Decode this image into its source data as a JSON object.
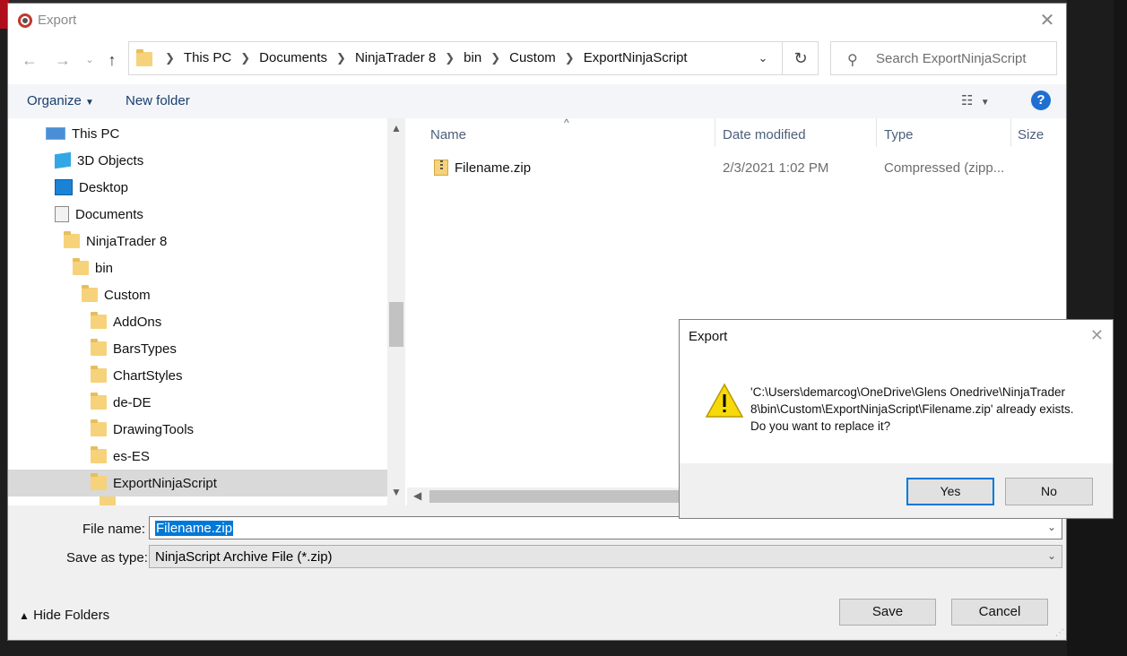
{
  "window": {
    "title": "Export"
  },
  "address": {
    "crumbs": [
      "This PC",
      "Documents",
      "NinjaTrader 8",
      "bin",
      "Custom",
      "ExportNinjaScript"
    ]
  },
  "search": {
    "placeholder": "Search ExportNinjaScript"
  },
  "commands": {
    "organize": "Organize",
    "new_folder": "New folder"
  },
  "tree": [
    {
      "label": "This PC",
      "icon": "pc-icon"
    },
    {
      "label": "3D Objects",
      "icon": "cube-icon"
    },
    {
      "label": "Desktop",
      "icon": "desktop-icon"
    },
    {
      "label": "Documents",
      "icon": "document-icon"
    },
    {
      "label": "NinjaTrader 8",
      "icon": "folder-icon"
    },
    {
      "label": "bin",
      "icon": "folder-icon"
    },
    {
      "label": "Custom",
      "icon": "folder-icon"
    },
    {
      "label": "AddOns",
      "icon": "folder-icon"
    },
    {
      "label": "BarsTypes",
      "icon": "folder-icon"
    },
    {
      "label": "ChartStyles",
      "icon": "folder-icon"
    },
    {
      "label": "de-DE",
      "icon": "folder-icon"
    },
    {
      "label": "DrawingTools",
      "icon": "folder-icon"
    },
    {
      "label": "es-ES",
      "icon": "folder-icon"
    },
    {
      "label": "ExportNinjaScript",
      "icon": "folder-icon",
      "selected": true
    }
  ],
  "columns": {
    "name": "Name",
    "date": "Date modified",
    "type": "Type",
    "size": "Size"
  },
  "files": [
    {
      "name": "Filename.zip",
      "date": "2/3/2021 1:02 PM",
      "type": "Compressed (zipp..."
    }
  ],
  "form": {
    "file_name_label": "File name:",
    "file_name_value": "Filename.zip",
    "save_type_label": "Save as type:",
    "save_type_value": "NinjaScript Archive File (*.zip)",
    "hide_folders": "Hide Folders",
    "save": "Save",
    "cancel": "Cancel"
  },
  "confirm": {
    "title": "Export",
    "message_line1": "'C:\\Users\\demarcog\\OneDrive\\Glens Onedrive\\NinjaTrader",
    "message_line2": "8\\bin\\Custom\\ExportNinjaScript\\Filename.zip' already exists.",
    "message_line3": "Do you want to replace it?",
    "yes": "Yes",
    "no": "No"
  },
  "colors": {
    "accent": "#0078d7",
    "link": "#1a3e6e",
    "warning": "#f5d90a"
  }
}
